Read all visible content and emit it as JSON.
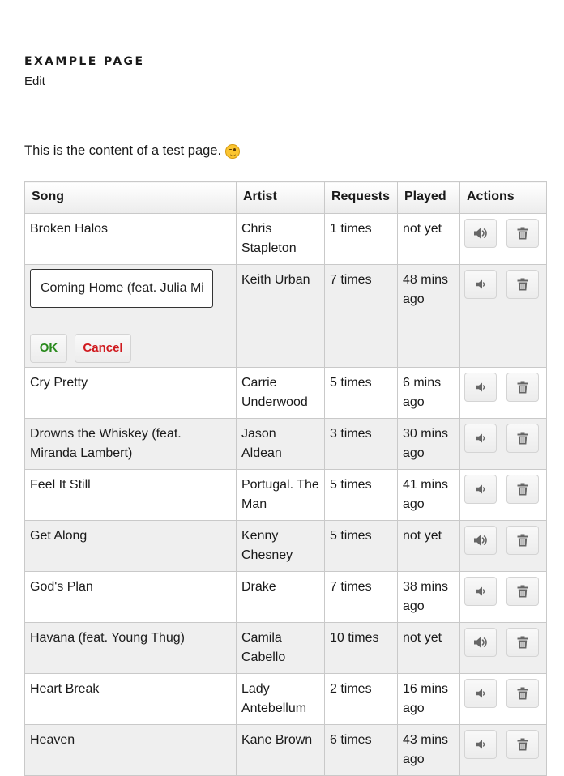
{
  "page": {
    "title": "EXAMPLE PAGE",
    "edit_label": "Edit",
    "content": "This is the content of a test page."
  },
  "table": {
    "headers": {
      "song": "Song",
      "artist": "Artist",
      "requests": "Requests",
      "played": "Played",
      "actions": "Actions"
    },
    "editing": {
      "input_value": "Coming Home (feat. Julia Michaels)",
      "ok_label": "OK",
      "cancel_label": "Cancel"
    },
    "rows": [
      {
        "song": "Broken Halos",
        "artist": "Chris Stapleton",
        "requests": "1 times",
        "played": "not yet",
        "play_icon": "speaker-loud-icon"
      },
      {
        "song": "Coming Home (feat. Julia Michaels)",
        "artist": "Keith Urban",
        "requests": "7 times",
        "played": "48 mins ago",
        "play_icon": "speaker-quiet-icon"
      },
      {
        "song": "Cry Pretty",
        "artist": "Carrie Underwood",
        "requests": "5 times",
        "played": "6 mins ago",
        "play_icon": "speaker-quiet-icon"
      },
      {
        "song": "Drowns the Whiskey (feat. Miranda Lambert)",
        "artist": "Jason Aldean",
        "requests": "3 times",
        "played": "30 mins ago",
        "play_icon": "speaker-quiet-icon"
      },
      {
        "song": "Feel It Still",
        "artist": "Portugal. The Man",
        "requests": "5 times",
        "played": "41 mins ago",
        "play_icon": "speaker-quiet-icon"
      },
      {
        "song": "Get Along",
        "artist": "Kenny Chesney",
        "requests": "5 times",
        "played": "not yet",
        "play_icon": "speaker-loud-icon"
      },
      {
        "song": "God's Plan",
        "artist": "Drake",
        "requests": "7 times",
        "played": "38 mins ago",
        "play_icon": "speaker-quiet-icon"
      },
      {
        "song": "Havana (feat. Young Thug)",
        "artist": "Camila Cabello",
        "requests": "10 times",
        "played": "not yet",
        "play_icon": "speaker-loud-icon"
      },
      {
        "song": "Heart Break",
        "artist": "Lady Antebellum",
        "requests": "2 times",
        "played": "16 mins ago",
        "play_icon": "speaker-quiet-icon"
      },
      {
        "song": "Heaven",
        "artist": "Kane Brown",
        "requests": "6 times",
        "played": "43 mins ago",
        "play_icon": "speaker-quiet-icon"
      }
    ]
  },
  "colors": {
    "ok": "#2a8a1e",
    "cancel": "#d0191e",
    "row_alt": "#efefef"
  }
}
